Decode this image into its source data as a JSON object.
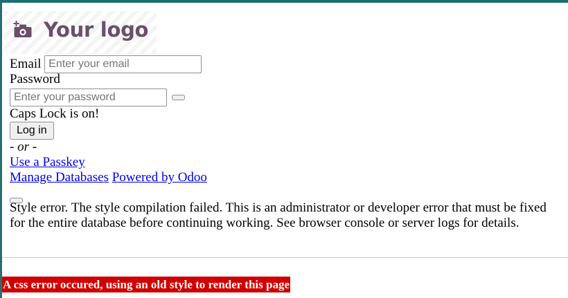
{
  "logo": {
    "text": "Your logo",
    "icon": "camera-plus-icon"
  },
  "login": {
    "email_label": "Email",
    "email_placeholder": "Enter your email",
    "email_value": "",
    "password_label": "Password",
    "password_placeholder": "Enter your password",
    "password_value": "",
    "caps_lock_warning": "Caps Lock is on!",
    "login_button": "Log in",
    "or_separator": "- or -",
    "passkey_link": "Use a Passkey"
  },
  "footer_links": {
    "manage_databases": "Manage Databases",
    "powered_by": "Powered by Odoo"
  },
  "style_error": {
    "message": "Style error. The style compilation failed. This is an administrator or developer error that must be fixed for the entire database before continuing working. See browser console or server logs for details."
  },
  "css_error_banner": "A css error occured, using an old style to render this page",
  "colors": {
    "logo_text": "#6a4f6a",
    "banner_bg": "#d00000",
    "link": "#0000ee"
  }
}
